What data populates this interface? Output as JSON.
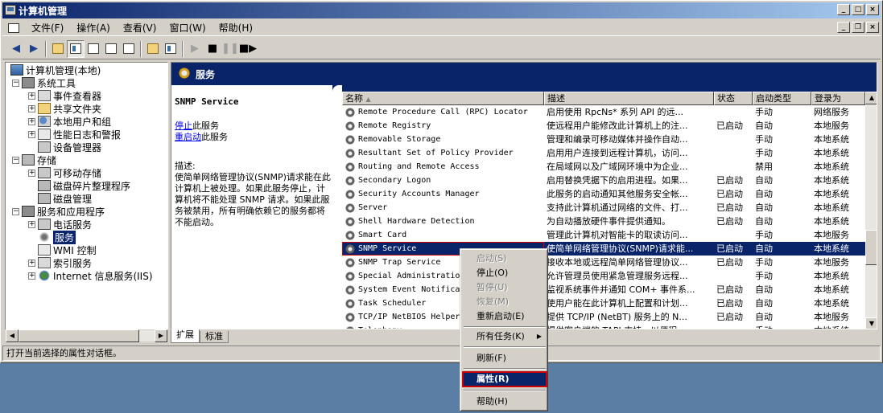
{
  "window": {
    "title": "计算机管理"
  },
  "menu": [
    "文件(F)",
    "操作(A)",
    "查看(V)",
    "窗口(W)",
    "帮助(H)"
  ],
  "tree": {
    "root": "计算机管理(本地)",
    "items": [
      {
        "label": "系统工具",
        "icon": "tools-icon",
        "level": 1,
        "exp": "−"
      },
      {
        "label": "事件查看器",
        "icon": "event-viewer-icon",
        "level": 2,
        "exp": "+"
      },
      {
        "label": "共享文件夹",
        "icon": "shared-folder-icon",
        "level": 2,
        "exp": "+"
      },
      {
        "label": "本地用户和组",
        "icon": "users-icon",
        "level": 2,
        "exp": "+"
      },
      {
        "label": "性能日志和警报",
        "icon": "performance-icon",
        "level": 2,
        "exp": "+"
      },
      {
        "label": "设备管理器",
        "icon": "device-manager-icon",
        "level": 2,
        "exp": ""
      },
      {
        "label": "存储",
        "icon": "storage-icon",
        "level": 1,
        "exp": "−"
      },
      {
        "label": "可移动存储",
        "icon": "removable-storage-icon",
        "level": 2,
        "exp": "+"
      },
      {
        "label": "磁盘碎片整理程序",
        "icon": "defrag-icon",
        "level": 2,
        "exp": ""
      },
      {
        "label": "磁盘管理",
        "icon": "disk-management-icon",
        "level": 2,
        "exp": ""
      },
      {
        "label": "服务和应用程序",
        "icon": "services-apps-icon",
        "level": 1,
        "exp": "−"
      },
      {
        "label": "电话服务",
        "icon": "telephony-icon",
        "level": 2,
        "exp": "+"
      },
      {
        "label": "服务",
        "icon": "services-gear-icon",
        "level": 2,
        "exp": "",
        "selected": true
      },
      {
        "label": "WMI 控制",
        "icon": "wmi-icon",
        "level": 2,
        "exp": ""
      },
      {
        "label": "索引服务",
        "icon": "index-icon",
        "level": 2,
        "exp": "+"
      },
      {
        "label": "Internet 信息服务(IIS)",
        "icon": "iis-globe-icon",
        "level": 2,
        "exp": "+"
      }
    ]
  },
  "pane": {
    "header": "服务",
    "selected_service": "SNMP Service",
    "stop_link": "停止",
    "stop_suffix": "此服务",
    "restart_link": "重启动",
    "restart_suffix": "此服务",
    "desc_label": "描述:",
    "desc_text": "使简单网络管理协议(SNMP)请求能在此计算机上被处理。如果此服务停止，计算机将不能处理 SNMP 请求。如果此服务被禁用，所有明确依赖它的服务都将不能启动。"
  },
  "columns": [
    "名称",
    "描述",
    "状态",
    "启动类型",
    "登录为"
  ],
  "services": [
    {
      "name": "Remote Procedure Call (RPC) Locator",
      "desc": "启用使用 RpcNs* 系列 API 的远...",
      "status": "",
      "startup": "手动",
      "logon": "网络服务"
    },
    {
      "name": "Remote Registry",
      "desc": "使远程用户能修改此计算机上的注...",
      "status": "已启动",
      "startup": "自动",
      "logon": "本地服务"
    },
    {
      "name": "Removable Storage",
      "desc": "管理和编录可移动媒体并操作自动...",
      "status": "",
      "startup": "手动",
      "logon": "本地系统"
    },
    {
      "name": "Resultant Set of Policy Provider",
      "desc": "启用用户连接到远程计算机，访问...",
      "status": "",
      "startup": "手动",
      "logon": "本地系统"
    },
    {
      "name": "Routing and Remote Access",
      "desc": "在局域网以及广域网环境中为企业...",
      "status": "",
      "startup": "禁用",
      "logon": "本地系统"
    },
    {
      "name": "Secondary Logon",
      "desc": "启用替换凭据下的启用进程。如果...",
      "status": "已启动",
      "startup": "自动",
      "logon": "本地系统"
    },
    {
      "name": "Security Accounts Manager",
      "desc": "此服务的启动通知其他服务安全帐...",
      "status": "已启动",
      "startup": "自动",
      "logon": "本地系统"
    },
    {
      "name": "Server",
      "desc": "支持此计算机通过网络的文件、打...",
      "status": "已启动",
      "startup": "自动",
      "logon": "本地系统"
    },
    {
      "name": "Shell Hardware Detection",
      "desc": "为自动播放硬件事件提供通知。",
      "status": "已启动",
      "startup": "自动",
      "logon": "本地系统"
    },
    {
      "name": "Smart Card",
      "desc": "管理此计算机对智能卡的取读访问...",
      "status": "",
      "startup": "手动",
      "logon": "本地服务"
    },
    {
      "name": "SNMP Service",
      "desc": "使简单网络管理协议(SNMP)请求能...",
      "status": "已启动",
      "startup": "自动",
      "logon": "本地系统",
      "selected": true
    },
    {
      "name": "SNMP Trap Service",
      "desc": "接收本地或远程简单网络管理协议...",
      "status": "已启动",
      "startup": "手动",
      "logon": "本地服务"
    },
    {
      "name": "Special Administration",
      "desc": "允许管理员使用紧急管理服务远程...",
      "status": "",
      "startup": "手动",
      "logon": "本地系统"
    },
    {
      "name": "System Event Notifica",
      "desc": "监视系统事件并通知 COM+ 事件系...",
      "status": "已启动",
      "startup": "自动",
      "logon": "本地系统"
    },
    {
      "name": "Task Scheduler",
      "desc": "使用户能在此计算机上配置和计划...",
      "status": "已启动",
      "startup": "自动",
      "logon": "本地系统"
    },
    {
      "name": "TCP/IP NetBIOS Helper",
      "desc": "提供 TCP/IP (NetBT) 服务上的 N...",
      "status": "已启动",
      "startup": "自动",
      "logon": "本地服务"
    },
    {
      "name": "Telephony",
      "desc": "提供客户端的 TAPI 支持，以便程...",
      "status": "",
      "startup": "手动",
      "logon": "本地系统"
    }
  ],
  "tabs": [
    "扩展",
    "标准"
  ],
  "status_text": "打开当前选择的属性对话框。",
  "context_menu": {
    "start": "启动(S)",
    "stop": "停止(O)",
    "pause": "暂停(U)",
    "resume": "恢复(M)",
    "restart": "重新启动(E)",
    "all_tasks": "所有任务(K)",
    "refresh": "刷新(F)",
    "properties": "属性(R)",
    "help": "帮助(H)"
  }
}
